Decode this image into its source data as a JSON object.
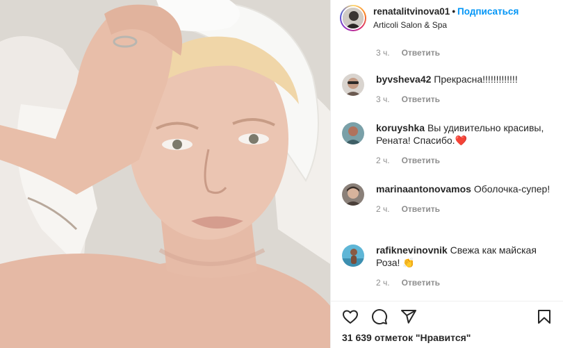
{
  "header": {
    "username": "renatalitvinova01",
    "dot": "•",
    "follow_label": "Подписаться",
    "location": "Articoli Salon & Spa",
    "avatar_icon": "profile-avatar"
  },
  "comments": {
    "top_meta": {
      "time": "3 ч.",
      "reply": "Ответить"
    },
    "items": [
      {
        "username": "byvsheva42",
        "text": "Прекрасна!!!!!!!!!!!!!",
        "time": "3 ч.",
        "reply": "Ответить"
      },
      {
        "username": "koruyshka",
        "text": "Вы удивительно красивы, Рената! Спасибо.❤️",
        "time": "2 ч.",
        "reply": "Ответить"
      },
      {
        "username": "marinaantonovamos",
        "text": "Оболочка-супер!",
        "time": "2 ч.",
        "reply": "Ответить"
      },
      {
        "username": "rafiknevinovnik",
        "text": "Свежа как майская Роза! 👏",
        "time": "2 ч.",
        "reply": "Ответить"
      }
    ]
  },
  "actions": {
    "icons": [
      "heart-icon",
      "comment-icon",
      "share-icon",
      "bookmark-icon"
    ]
  },
  "likes": {
    "text": "31 639 отметок \"Нравится\""
  },
  "colors": {
    "link_blue": "#0095f6",
    "muted": "#8e8e8e",
    "text": "#262626",
    "border": "#efefef"
  }
}
